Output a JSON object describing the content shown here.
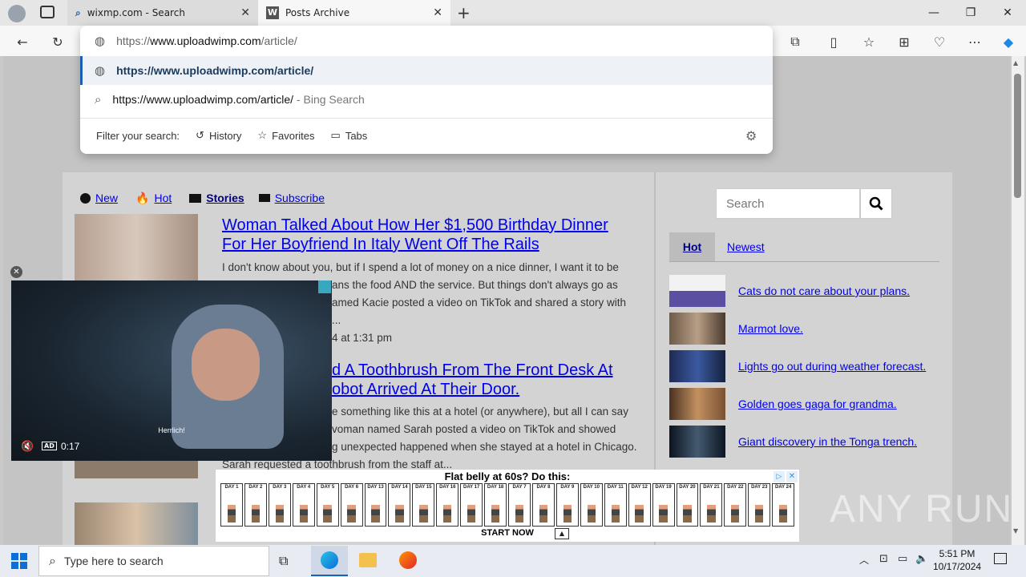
{
  "browser": {
    "tabs": [
      {
        "title": "wixmp.com - Search"
      },
      {
        "title": "Posts Archive"
      }
    ],
    "address": {
      "url_prefix": "https://",
      "url_host": "www.uploadwimp.com",
      "url_path": "/article/"
    },
    "suggestions": [
      {
        "text": "https://www.uploadwimp.com/article/",
        "suffix": ""
      },
      {
        "text": "https://www.uploadwimp.com/article/",
        "suffix": "- Bing Search"
      }
    ],
    "filter": {
      "label": "Filter your search:",
      "options": [
        "History",
        "Favorites",
        "Tabs"
      ]
    }
  },
  "site": {
    "nav": [
      {
        "label": "New"
      },
      {
        "label": "Hot"
      },
      {
        "label": "Stories"
      },
      {
        "label": "Subscribe"
      }
    ],
    "articles": [
      {
        "title_line1": "Woman Talked About How Her $1,500 Birthday Dinner",
        "title_line2": "For Her Boyfriend In Italy Went Off The Rails",
        "excerpt_line1": "I don't know about you, but if I spend a lot of money on a nice dinner, I want it to be",
        "excerpt_line2": "ans the food AND the service. But things don't always go as",
        "excerpt_line3": "amed Kacie posted a video on TikTok and shared a story with",
        "excerpt_line4": "...",
        "date": "4 at 1:31 pm"
      },
      {
        "title_line1": "d A Toothbrush From The Front Desk At",
        "title_line2": "obot Arrived At Their Door.",
        "excerpt_line1": "e something like this at a hotel (or anywhere), but all I can say",
        "excerpt_line2": "voman named Sarah posted a video on TikTok and showed",
        "excerpt_line3": "g unexpected happened when she stayed at a hotel in Chicago.",
        "excerpt_line4": "Sarah requested a toothbrush from the staff at..."
      }
    ],
    "sidebar": {
      "search_placeholder": "Search",
      "tabs": [
        "Hot",
        "Newest"
      ],
      "items": [
        {
          "label": "Cats do not care about your plans."
        },
        {
          "label": "Marmot love."
        },
        {
          "label": "Lights go out during weather forecast."
        },
        {
          "label": "Golden goes gaga for grandma."
        },
        {
          "label": "Giant discovery in the Tonga trench."
        }
      ]
    },
    "video": {
      "subtitle": "Herrlich!",
      "time": "0:17",
      "ad_badge": "AD"
    },
    "ad": {
      "headline": "Flat belly at 60s? Do this:",
      "cta": "START NOW",
      "days": [
        "DAY 1",
        "DAY 2",
        "DAY 3",
        "DAY 4",
        "DAY 5",
        "DAY 6",
        "DAY 13",
        "DAY 14",
        "DAY 15",
        "DAY 16",
        "DAY 17",
        "DAY 18",
        "DAY 7",
        "DAY 8",
        "DAY 9",
        "DAY 10",
        "DAY 11",
        "DAY 12",
        "DAY 19",
        "DAY 20",
        "DAY 21",
        "DAY 22",
        "DAY 23",
        "DAY 24"
      ]
    },
    "watermark": "ANY RUN"
  },
  "taskbar": {
    "search_placeholder": "Type here to search",
    "time": "5:51 PM",
    "date": "10/17/2024"
  },
  "colors": {
    "link": "#0000ee",
    "accent": "#1a5fb4"
  }
}
